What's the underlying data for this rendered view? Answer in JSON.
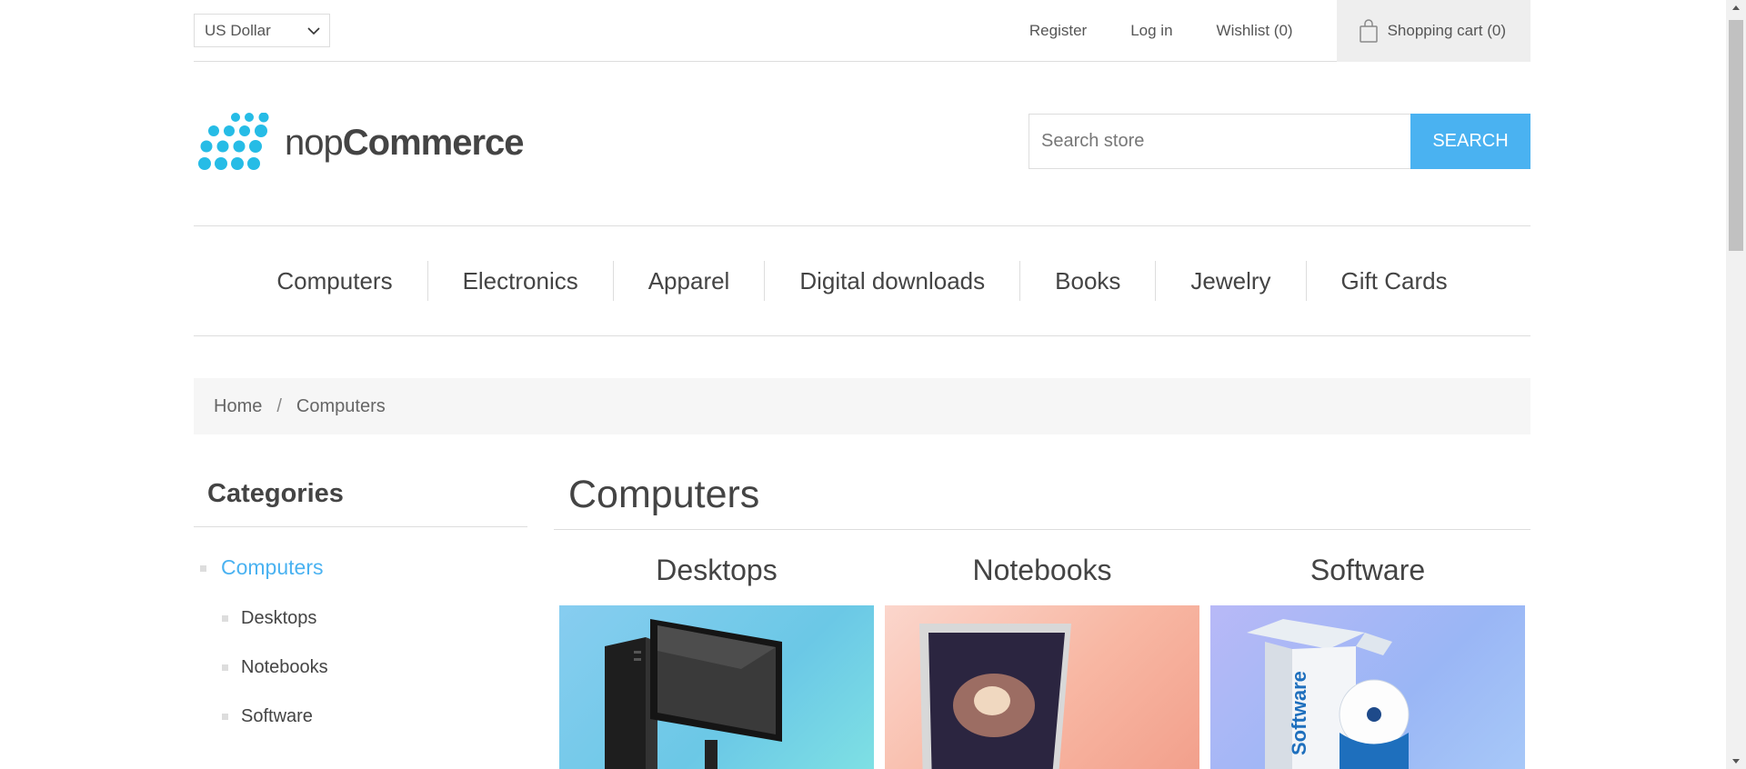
{
  "header": {
    "currency": "US Dollar",
    "links": {
      "register": "Register",
      "login": "Log in",
      "wishlist": "Wishlist (0)",
      "cart": "Shopping cart (0)"
    }
  },
  "logo": {
    "prefix": "nop",
    "suffix": "Commerce"
  },
  "search": {
    "placeholder": "Search store",
    "button": "SEARCH"
  },
  "menu": [
    "Computers",
    "Electronics",
    "Apparel",
    "Digital downloads",
    "Books",
    "Jewelry",
    "Gift Cards"
  ],
  "breadcrumb": {
    "home": "Home",
    "separator": "/",
    "current": "Computers"
  },
  "side": {
    "title": "Categories",
    "active": "Computers",
    "subs": [
      "Desktops",
      "Notebooks",
      "Software"
    ]
  },
  "main": {
    "title": "Computers",
    "categories": [
      "Desktops",
      "Notebooks",
      "Software"
    ]
  },
  "colors": {
    "accent": "#4ab2f1",
    "text": "#444444",
    "border": "#dddddd"
  },
  "icons": [
    "chevron-down-icon",
    "shopping-bag-icon",
    "scroll-up-icon",
    "scroll-down-icon"
  ]
}
